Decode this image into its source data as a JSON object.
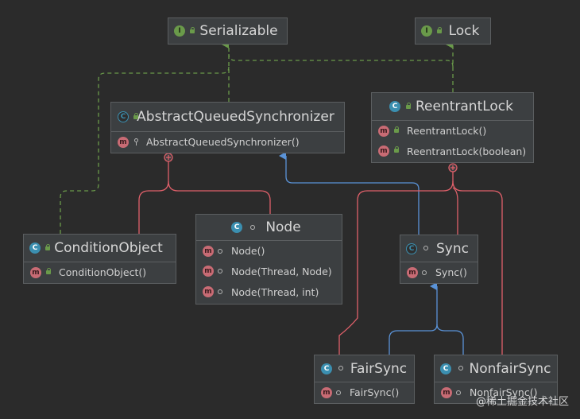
{
  "diagram": {
    "nodes": {
      "serializable": {
        "name": "Serializable",
        "kind": "interface-icon",
        "members": []
      },
      "lock": {
        "name": "Lock",
        "kind": "interface-icon",
        "members": []
      },
      "aqs": {
        "name": "AbstractQueuedSynchronizer",
        "kind": "abstract-class-icon",
        "members": [
          "AbstractQueuedSynchronizer()"
        ]
      },
      "reentrant_lock": {
        "name": "ReentrantLock",
        "kind": "class-icon",
        "members": [
          "ReentrantLock()",
          "ReentrantLock(boolean)"
        ]
      },
      "condition_object": {
        "name": "ConditionObject",
        "kind": "class-icon",
        "members": [
          "ConditionObject()"
        ]
      },
      "node": {
        "name": "Node",
        "kind": "static-class-icon",
        "members": [
          "Node()",
          "Node(Thread, Node)",
          "Node(Thread, int)"
        ]
      },
      "sync": {
        "name": "Sync",
        "kind": "static-abstract-class-icon",
        "members": [
          "Sync()"
        ]
      },
      "fair_sync": {
        "name": "FairSync",
        "kind": "static-class-icon",
        "members": [
          "FairSync()"
        ]
      },
      "nonfair_sync": {
        "name": "NonfairSync",
        "kind": "static-class-icon",
        "members": [
          "NonfairSync()"
        ]
      }
    },
    "colors": {
      "background": "#2b2b2b",
      "implements": "#6a9a4a",
      "extends": "#5a93d8",
      "inner": "#e0606a"
    }
  },
  "watermark": "@稀土掘金技术社区"
}
